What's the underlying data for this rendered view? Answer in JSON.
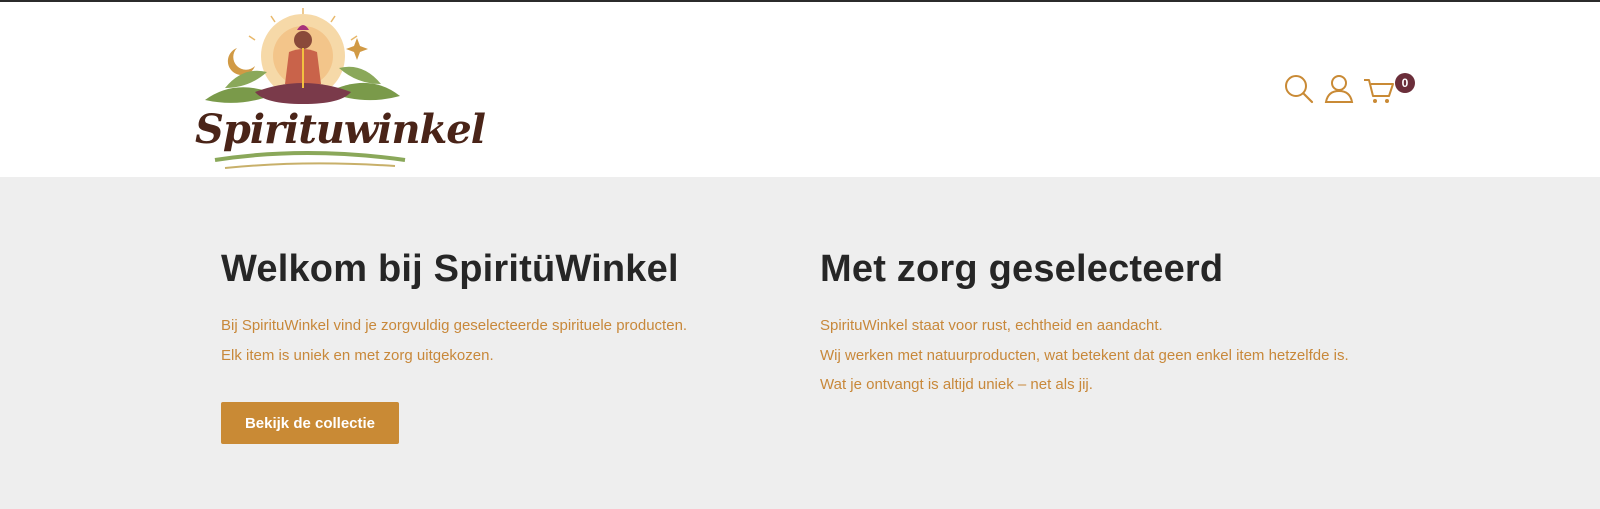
{
  "brand": {
    "name": "Spirituwinkel"
  },
  "header": {
    "icons": [
      "search-icon",
      "user-icon",
      "cart-icon"
    ],
    "cart_count": "0"
  },
  "hero": {
    "left": {
      "title": "Welkom bij SpiritüWinkel",
      "lines": [
        "Bij SpirituWinkel vind je zorgvuldig geselecteerde spirituele producten.",
        "Elk item is uniek en met zorg uitgekozen."
      ],
      "button_label": "Bekijk de collectie"
    },
    "right": {
      "title": "Met zorg geselecteerd",
      "lines": [
        "SpirituWinkel staat voor rust, echtheid en aandacht.",
        "Wij werken met natuurproducten, wat betekent dat geen enkel item hetzelfde is.",
        "Wat je ontvangt is altijd uniek – net als jij."
      ]
    }
  },
  "colors": {
    "accent": "#c98a35",
    "text_accent": "#c8883a",
    "heading": "#262626",
    "band": "#eeeeee",
    "badge": "#6b2e3a"
  }
}
